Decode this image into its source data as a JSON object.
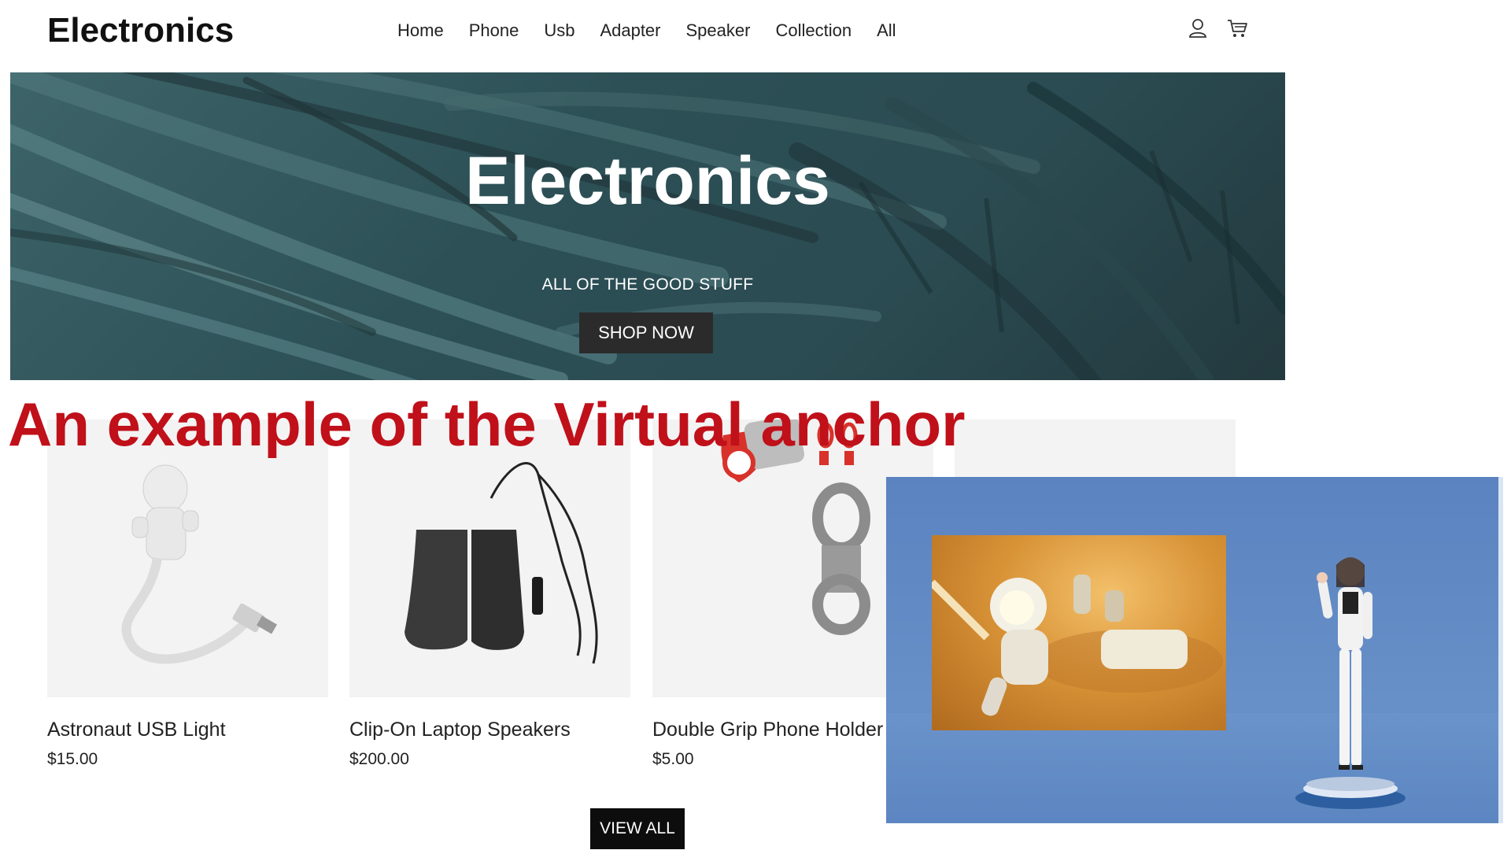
{
  "header": {
    "brand": "Electronics",
    "nav": [
      "Home",
      "Phone",
      "Usb",
      "Adapter",
      "Speaker",
      "Collection",
      "All"
    ],
    "icons": [
      "user-icon",
      "cart-icon"
    ]
  },
  "hero": {
    "title": "Electronics",
    "subtitle": "ALL OF THE GOOD STUFF",
    "cta": "SHOP NOW"
  },
  "products": [
    {
      "name": "Astronaut USB Light",
      "price": "$15.00"
    },
    {
      "name": "Clip-On Laptop Speakers",
      "price": "$200.00"
    },
    {
      "name": "Double Grip Phone Holder",
      "price": "$5.00"
    }
  ],
  "view_all": "VIEW ALL",
  "overlay_caption": "An example of the Virtual anchor",
  "colors": {
    "caption": "#c0101a",
    "hero_bg": "#2c5056",
    "anchor_bg": "#6790c8",
    "button_dark": "#2b2b2b"
  }
}
